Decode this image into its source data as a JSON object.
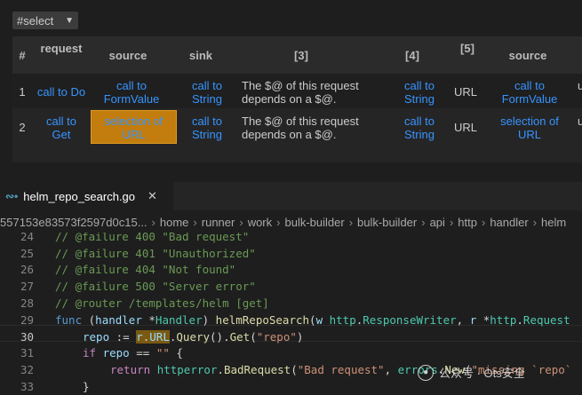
{
  "select": {
    "value": "#select"
  },
  "table": {
    "headers": [
      "#",
      "request",
      "source",
      "sink",
      "[3]",
      "[4]",
      "[5]",
      "source"
    ],
    "rows": [
      {
        "num": "1",
        "request": "call to Do",
        "source_a": "call to",
        "source_b": "FormValue",
        "sink_a": "call to",
        "sink_b": "String",
        "c3_a": "The $@ of this request",
        "c3_b": "depends on a $@.",
        "c4_a": "call to",
        "c4_b": "String",
        "c5": "URL",
        "src2_a": "call to",
        "src2_b": "FormValue",
        "clip": "u"
      },
      {
        "num": "2",
        "request_a": "call to",
        "request_b": "Get",
        "source_a": "selection of",
        "source_b": "URL",
        "sink_a": "call to",
        "sink_b": "String",
        "c3_a": "The $@ of this request",
        "c3_b": "depends on a $@.",
        "c4_a": "call to",
        "c4_b": "String",
        "c5": "URL",
        "src2_a": "selection of",
        "src2_b": "URL",
        "clip": "u"
      }
    ]
  },
  "editor": {
    "tab_label": "helm_repo_search.go",
    "breadcrumb": [
      "557153e83573f2597d0c15...",
      "home",
      "runner",
      "work",
      "bulk-builder",
      "bulk-builder",
      "api",
      "http",
      "handler",
      "helm"
    ],
    "lines": [
      {
        "n": "24",
        "text": "// @failure 400 \"Bad request\""
      },
      {
        "n": "25",
        "text": "// @failure 401 \"Unauthorized\""
      },
      {
        "n": "26",
        "text": "// @failure 404 \"Not found\""
      },
      {
        "n": "27",
        "text": "// @failure 500 \"Server error\""
      },
      {
        "n": "28",
        "text": "// @router /templates/helm [get]"
      },
      {
        "n": "29"
      },
      {
        "n": "30"
      },
      {
        "n": "31"
      },
      {
        "n": "32"
      },
      {
        "n": "33",
        "text": "}"
      }
    ],
    "code29": {
      "func": "func",
      "p1": " (",
      "handler": "handler",
      "star": " *",
      "Handler": "Handler",
      "p2": ") ",
      "name": "helmRepoSearch",
      "p3": "(",
      "w": "w",
      "sp": " ",
      "http1": "http",
      "dot": ".",
      "RW": "ResponseWriter",
      "comma": ", ",
      "r": "r",
      "star2": " *",
      "http2": "http",
      "dot2": ".",
      "Req": "Request"
    },
    "code30": {
      "repo": "repo",
      "assign": " := ",
      "r": "r",
      "dot": ".",
      "URL": "URL",
      "dot2": ".",
      "Query": "Query",
      "paren": "().",
      "Get": "Get",
      "po": "(",
      "str": "\"repo\"",
      "pc": ")"
    },
    "code31": {
      "if": "if",
      "repo": " repo",
      "eq": " == ",
      "str": "\"\"",
      "br": " {"
    },
    "code32": {
      "ret": "return",
      "sp": " ",
      "pkg": "httperror",
      "dot": ".",
      "fn": "BadRequest",
      "po": "(",
      "str": "\"Bad request\"",
      "comma": ", ",
      "errors": "errors",
      "dot2": ".",
      "New": "New",
      "po2": "(",
      "str2": "\"missing `repo`"
    }
  },
  "watermark": {
    "text": "公众号 · Ots安全"
  },
  "colors": {
    "link": "#3794ff",
    "highlight": "#c27d0e",
    "bg": "#1e1e1e"
  }
}
